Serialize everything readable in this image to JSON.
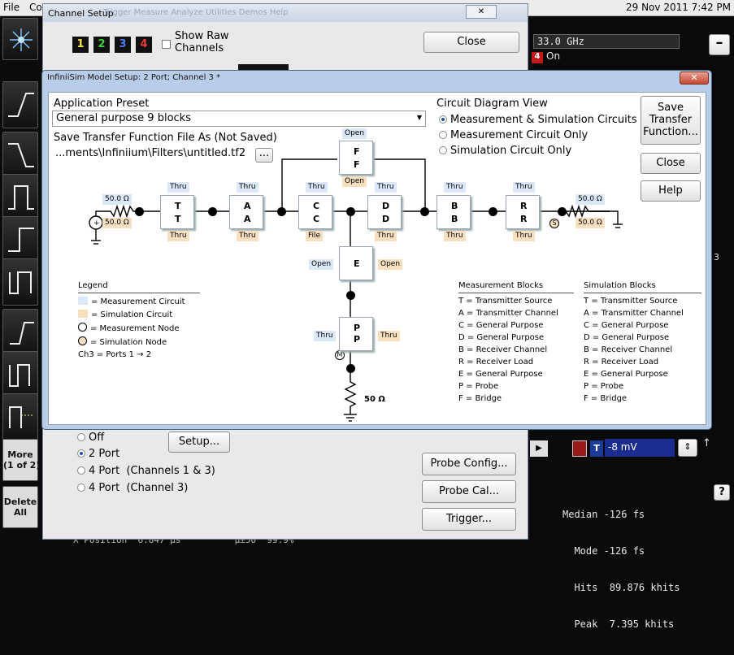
{
  "menubar": {
    "file": "File",
    "co": "Co",
    "datetime": "29 Nov 2011  7:42 PM"
  },
  "leftbar": {
    "more": "More\n(1 of 2)",
    "delete": "Delete\nAll"
  },
  "rightpanel": {
    "freq": "33.0 GHz",
    "on_label": "On",
    "ch4_label": "4",
    "offset": "-8 mV",
    "side_char": "3",
    "stats": [
      "Median -126 fs",
      "  Mode -126 fs",
      "  Hits  89.876 khits",
      "  Peak  7.395 khits"
    ],
    "help_q": "?",
    "bottom": "X Position  6.847 μs          μ±50  99.9%"
  },
  "channel_setup": {
    "title": "Channel Setup",
    "menu_ghost": "Trigger   Measure   Analyze   Utilities   Demos   Help",
    "close_x": "✕",
    "channels": [
      "1",
      "2",
      "3",
      "4"
    ],
    "show_raw": "Show Raw\nChannels",
    "close_btn": "Close",
    "radio_off": "Off",
    "radio_2port": "2 Port",
    "radio_4port_13": "4 Port  (Channels 1 & 3)",
    "radio_4port_3": "4 Port  (Channel 3)",
    "setup_btn": "Setup...",
    "probe_config": "Probe Config...",
    "probe_cal": "Probe Cal...",
    "trigger": "Trigger..."
  },
  "dialog": {
    "title": "InfiniiSim Model Setup: 2 Port; Channel 3 *",
    "close": "✕",
    "app_preset_label": "Application Preset",
    "app_preset_value": "General purpose 9 blocks",
    "save_tf_label": "Save Transfer Function File As (Not Saved)",
    "save_tf_path": "...ments\\Infiniium\\Filters\\untitled.tf2",
    "browse": "...",
    "circuit_view_label": "Circuit Diagram View",
    "view_options": [
      "Measurement & Simulation Circuits",
      "Measurement Circuit Only",
      "Simulation Circuit Only"
    ],
    "buttons": {
      "save_tf": "Save\nTransfer\nFunction...",
      "close": "Close",
      "help": "Help"
    },
    "circuit": {
      "src_r_top": "50.0 Ω",
      "src_r_bot": "50.0 Ω",
      "load_r_top": "50.0 Ω",
      "load_r_bot": "50.0 Ω",
      "probe_r": "50 Ω",
      "blocks": [
        {
          "letter": "T",
          "top": "Thru",
          "bot": "Thru"
        },
        {
          "letter": "A",
          "top": "Thru",
          "bot": "Thru"
        },
        {
          "letter": "C",
          "top": "Thru",
          "bot": "File"
        },
        {
          "letter": "D",
          "top": "Thru",
          "bot": "Thru"
        },
        {
          "letter": "B",
          "top": "Thru",
          "bot": "Thru"
        },
        {
          "letter": "R",
          "top": "Thru",
          "bot": "Thru"
        }
      ],
      "f_block": {
        "letter": "F",
        "top": "Open",
        "bot": "Open"
      },
      "e_block": {
        "letter": "E",
        "left": "Open",
        "right": "Open"
      },
      "p_block": {
        "letter": "P",
        "left": "Thru",
        "right": "Thru"
      },
      "port1": "1",
      "port2": "2",
      "m_node": "M",
      "s_node": "S"
    },
    "legend": {
      "title": "Legend",
      "items": [
        "= Measurement Circuit",
        "= Simulation Circuit",
        "= Measurement Node",
        "= Simulation Node"
      ],
      "ports": "Ch3 = Ports 1 → 2",
      "colors": {
        "measurement": "#dbe8f7",
        "simulation": "#f7dfc0"
      }
    },
    "measurement_blocks": {
      "title": "Measurement Blocks",
      "items": [
        "T = Transmitter Source",
        "A = Transmitter Channel",
        "C = General Purpose",
        "D = General Purpose",
        "B = Receiver Channel",
        "R = Receiver Load",
        "E = General Purpose",
        "P = Probe",
        "F = Bridge"
      ]
    },
    "simulation_blocks": {
      "title": "Simulation Blocks",
      "items": [
        "T = Transmitter Source",
        "A = Transmitter Channel",
        "C = General Purpose",
        "D = General Purpose",
        "B = Receiver Channel",
        "R = Receiver Load",
        "E = General Purpose",
        "P = Probe",
        "F = Bridge"
      ]
    }
  }
}
